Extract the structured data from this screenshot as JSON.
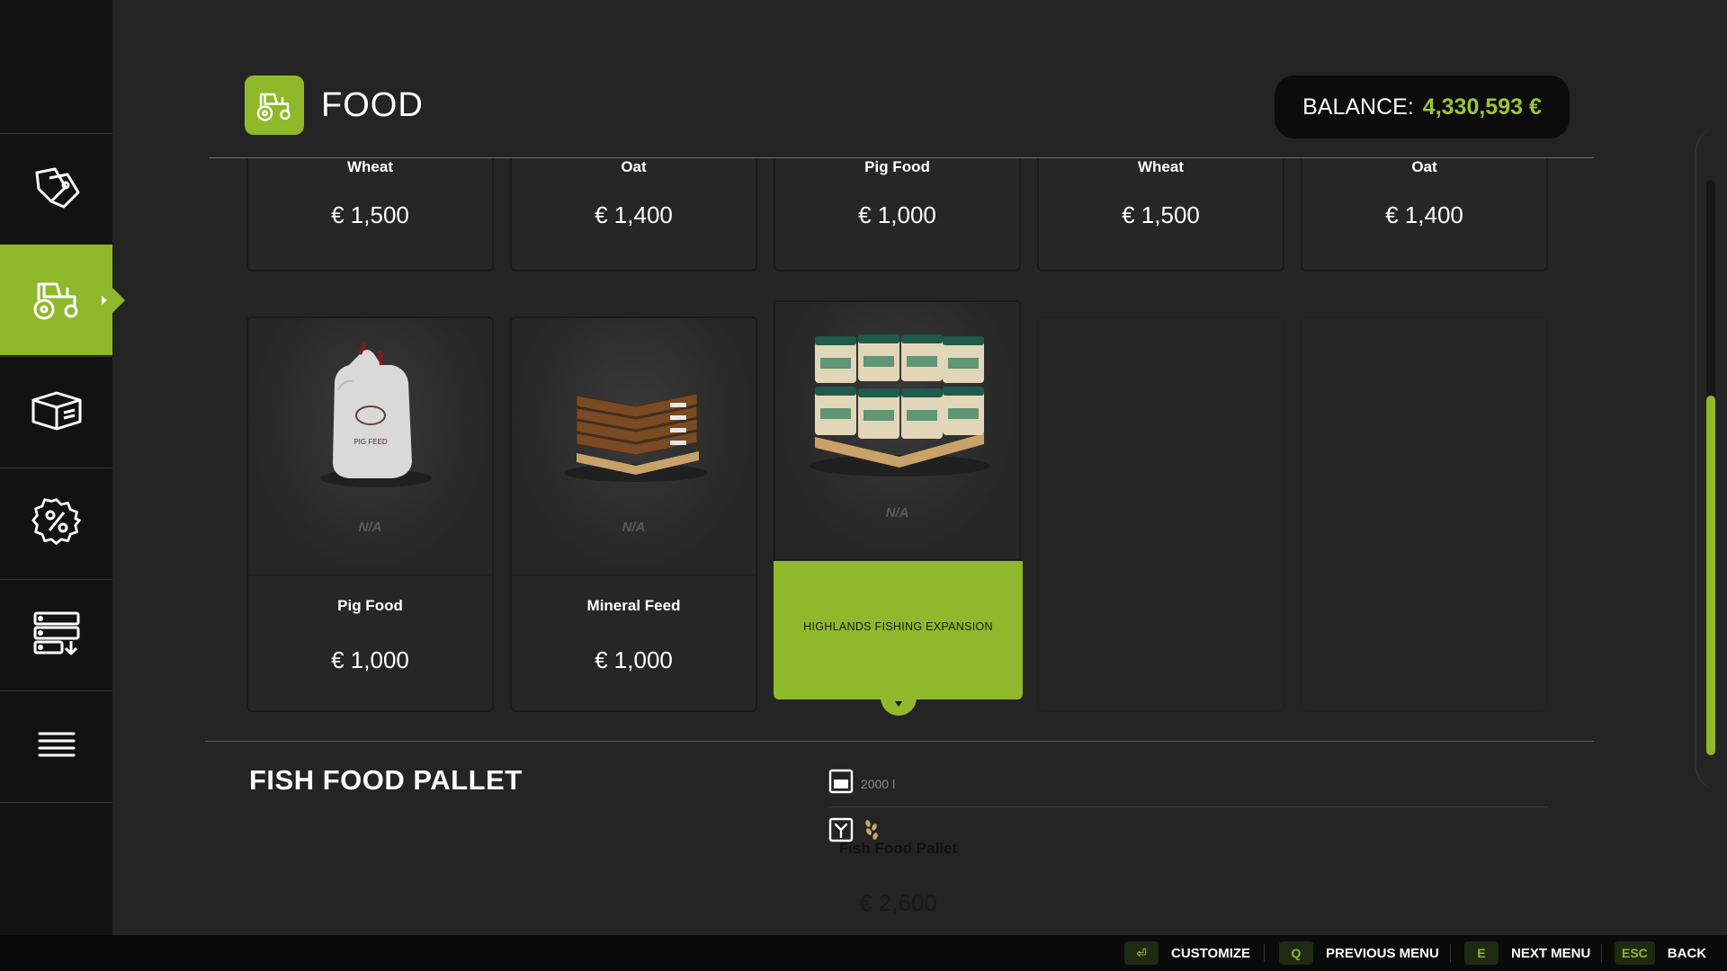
{
  "header": {
    "title": "FOOD",
    "balance_label": "BALANCE:",
    "balance_value": "4,330,593 €"
  },
  "sidebar": {
    "items": [
      {
        "icon": "price-tags-icon"
      },
      {
        "icon": "tractor-icon",
        "active": true
      },
      {
        "icon": "box-icon"
      },
      {
        "icon": "percent-badge-icon"
      },
      {
        "icon": "server-download-icon"
      },
      {
        "icon": "menu-lines-icon"
      }
    ]
  },
  "top_row": [
    {
      "name": "Wheat",
      "price": "€ 1,500"
    },
    {
      "name": "Oat",
      "price": "€ 1,400"
    },
    {
      "name": "Pig Food",
      "price": "€ 1,000"
    },
    {
      "name": "Wheat",
      "price": "€ 1,500"
    },
    {
      "name": "Oat",
      "price": "€ 1,400"
    }
  ],
  "items": [
    {
      "name": "Pig Food",
      "price": "€ 1,000",
      "availability": "N/A",
      "bag_text": "PIG FEED"
    },
    {
      "name": "Mineral Feed",
      "price": "€ 1,000",
      "availability": "N/A"
    },
    {
      "name": "Fish Food Pallet",
      "price": "€ 2,600",
      "availability": "N/A",
      "dlc": "HIGHLANDS FISHING EXPANSION",
      "selected": true
    }
  ],
  "detail": {
    "title": "FISH FOOD PALLET",
    "capacity": "2000 l"
  },
  "footer": {
    "customize": {
      "key": "⏎",
      "label": "CUSTOMIZE"
    },
    "previous": {
      "key": "Q",
      "label": "PREVIOUS MENU"
    },
    "next": {
      "key": "E",
      "label": "NEXT MENU"
    },
    "back": {
      "key": "ESC",
      "label": "BACK"
    }
  },
  "colors": {
    "accent": "#8fb82a",
    "balance_value": "#9bc43a",
    "background": "#242424",
    "sidebar": "#121212"
  }
}
